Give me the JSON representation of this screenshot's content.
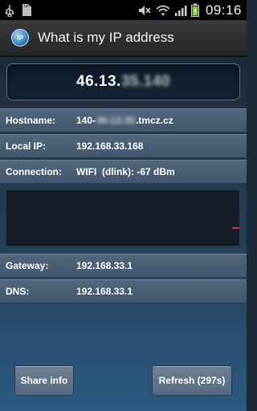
{
  "status_bar": {
    "time": "09:16",
    "icons": [
      "usb-icon",
      "sd-card-icon",
      "mute-icon",
      "wifi-icon",
      "signal-icon",
      "battery-icon"
    ]
  },
  "action_bar": {
    "app_icon_text": "IP",
    "title": "What is my IP address"
  },
  "ip": {
    "visible": "46.13.",
    "hidden": "35.140"
  },
  "rows": {
    "hostname": {
      "label": "Hostname:",
      "value_prefix": "140-",
      "value_hidden": "46-13-35",
      "value_suffix": ".tmcz.cz"
    },
    "local_ip": {
      "label": "Local IP:",
      "value": "192.168.33.168"
    },
    "connection": {
      "label": "Connection:",
      "value": "WIFI  (dlink): -67 dBm"
    },
    "gateway": {
      "label": "Gateway:",
      "value": "192.168.33.1"
    },
    "dns": {
      "label": "DNS:",
      "value": "192.168.33.1"
    }
  },
  "buttons": {
    "share": "Share info",
    "refresh": "Refresh (297s)"
  },
  "colors": {
    "signal_marker": "#e2262a",
    "accent": "#2a78b8"
  }
}
